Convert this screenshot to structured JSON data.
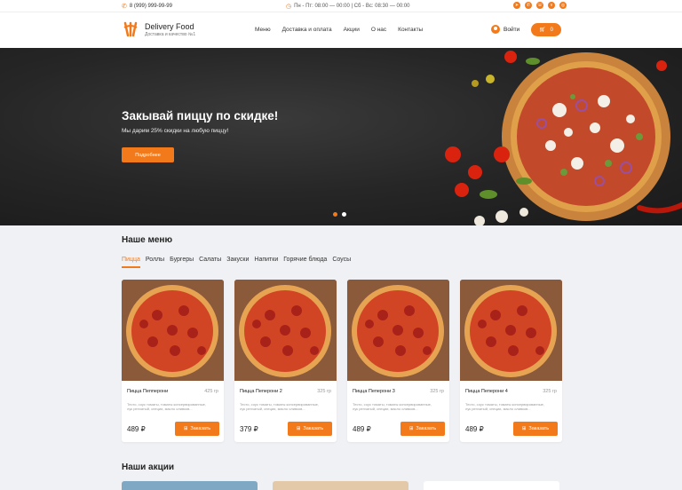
{
  "topbar": {
    "phone": "8 (999) 999-99-99",
    "hours": "Пн - Пт: 08:00 — 00:00 | Сб - Вс: 08:30 — 00:00",
    "socials": [
      "telegram-icon",
      "whatsapp-icon",
      "viber-icon",
      "vk-icon",
      "instagram-icon"
    ]
  },
  "header": {
    "logo_title": "Delivery Food",
    "logo_subtitle": "Доставка и качество №1",
    "nav": [
      "Меню",
      "Доставка и оплата",
      "Акции",
      "О нас",
      "Контакты"
    ],
    "login_label": "Войти",
    "cart_count": "0"
  },
  "hero": {
    "title": "Закывай пиццу по скидке!",
    "subtitle": "Мы дарим 25% скидки на любую пиццу!",
    "button": "Подробнее",
    "slides_total": 2,
    "active_slide": 1
  },
  "menu": {
    "title": "Наше меню",
    "tabs": [
      "Пицца",
      "Роллы",
      "Бургеры",
      "Салаты",
      "Закуски",
      "Напитки",
      "Горячие блюда",
      "Соусы"
    ],
    "active_tab": 0,
    "cards": [
      {
        "name": "Пицца Пепперони",
        "weight": "425 гр",
        "desc": "Тесто, соус томаты, томаты консервированные, лук репчатый, специи, масло оливков...",
        "price": "489 ₽",
        "button": "Заказать"
      },
      {
        "name": "Пицца Пеперони 2",
        "weight": "325 гр",
        "desc": "Тесто, соус томаты, томаты консервированные, лук репчатый, специи, масло оливков...",
        "price": "379 ₽",
        "button": "Заказать"
      },
      {
        "name": "Пицца Пеперони 3",
        "weight": "325 гр",
        "desc": "Тесто, соус томаты, томаты консервированные, лук репчатый, специи, масло оливков...",
        "price": "489 ₽",
        "button": "Заказать"
      },
      {
        "name": "Пицца Пеперони 4",
        "weight": "325 гр",
        "desc": "Тесто, соус томаты, томаты консервированные, лук репчатый, специи, масло оливков...",
        "price": "489 ₽",
        "button": "Заказать"
      }
    ]
  },
  "promo": {
    "title": "Наши акции"
  },
  "colors": {
    "accent": "#f27a1a",
    "page_bg": "#f0f1f4",
    "hero_bg": "#262626"
  }
}
